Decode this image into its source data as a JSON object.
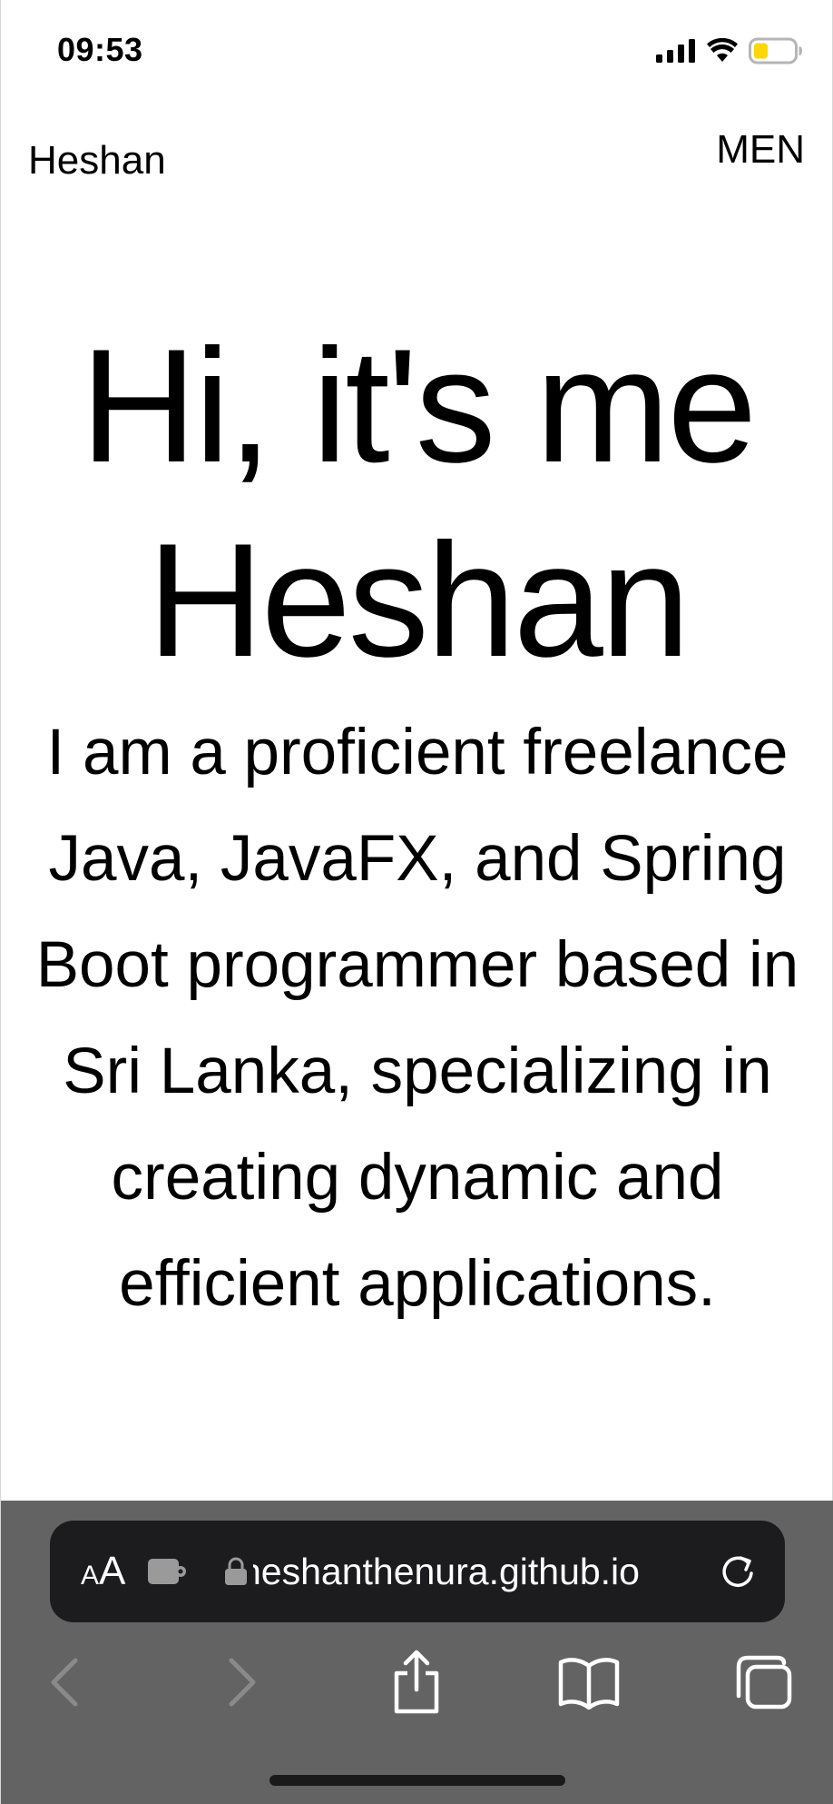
{
  "status_bar": {
    "time": "09:53",
    "icons": [
      "cellular-signal-icon",
      "wifi-icon",
      "battery-low-icon"
    ],
    "battery_color": "#ffd60a"
  },
  "header": {
    "brand": "Heshan",
    "menu_label": "MEN"
  },
  "hero": {
    "title_line1": "Hi, it's me",
    "title_line2": "Heshan",
    "description": "I am a proficient freelance Java, JavaFX, and Spring Boot programmer based in Sri Lanka, specializing in creating dynamic and efficient applications."
  },
  "browser": {
    "aa_small": "A",
    "aa_big": "A",
    "url": "heshanthenura.github.io",
    "toolbar_color": "#636363",
    "address_bar_color": "#1c1c1e",
    "buttons": [
      "back-icon",
      "forward-icon",
      "share-icon",
      "bookmarks-icon",
      "tabs-icon"
    ]
  }
}
